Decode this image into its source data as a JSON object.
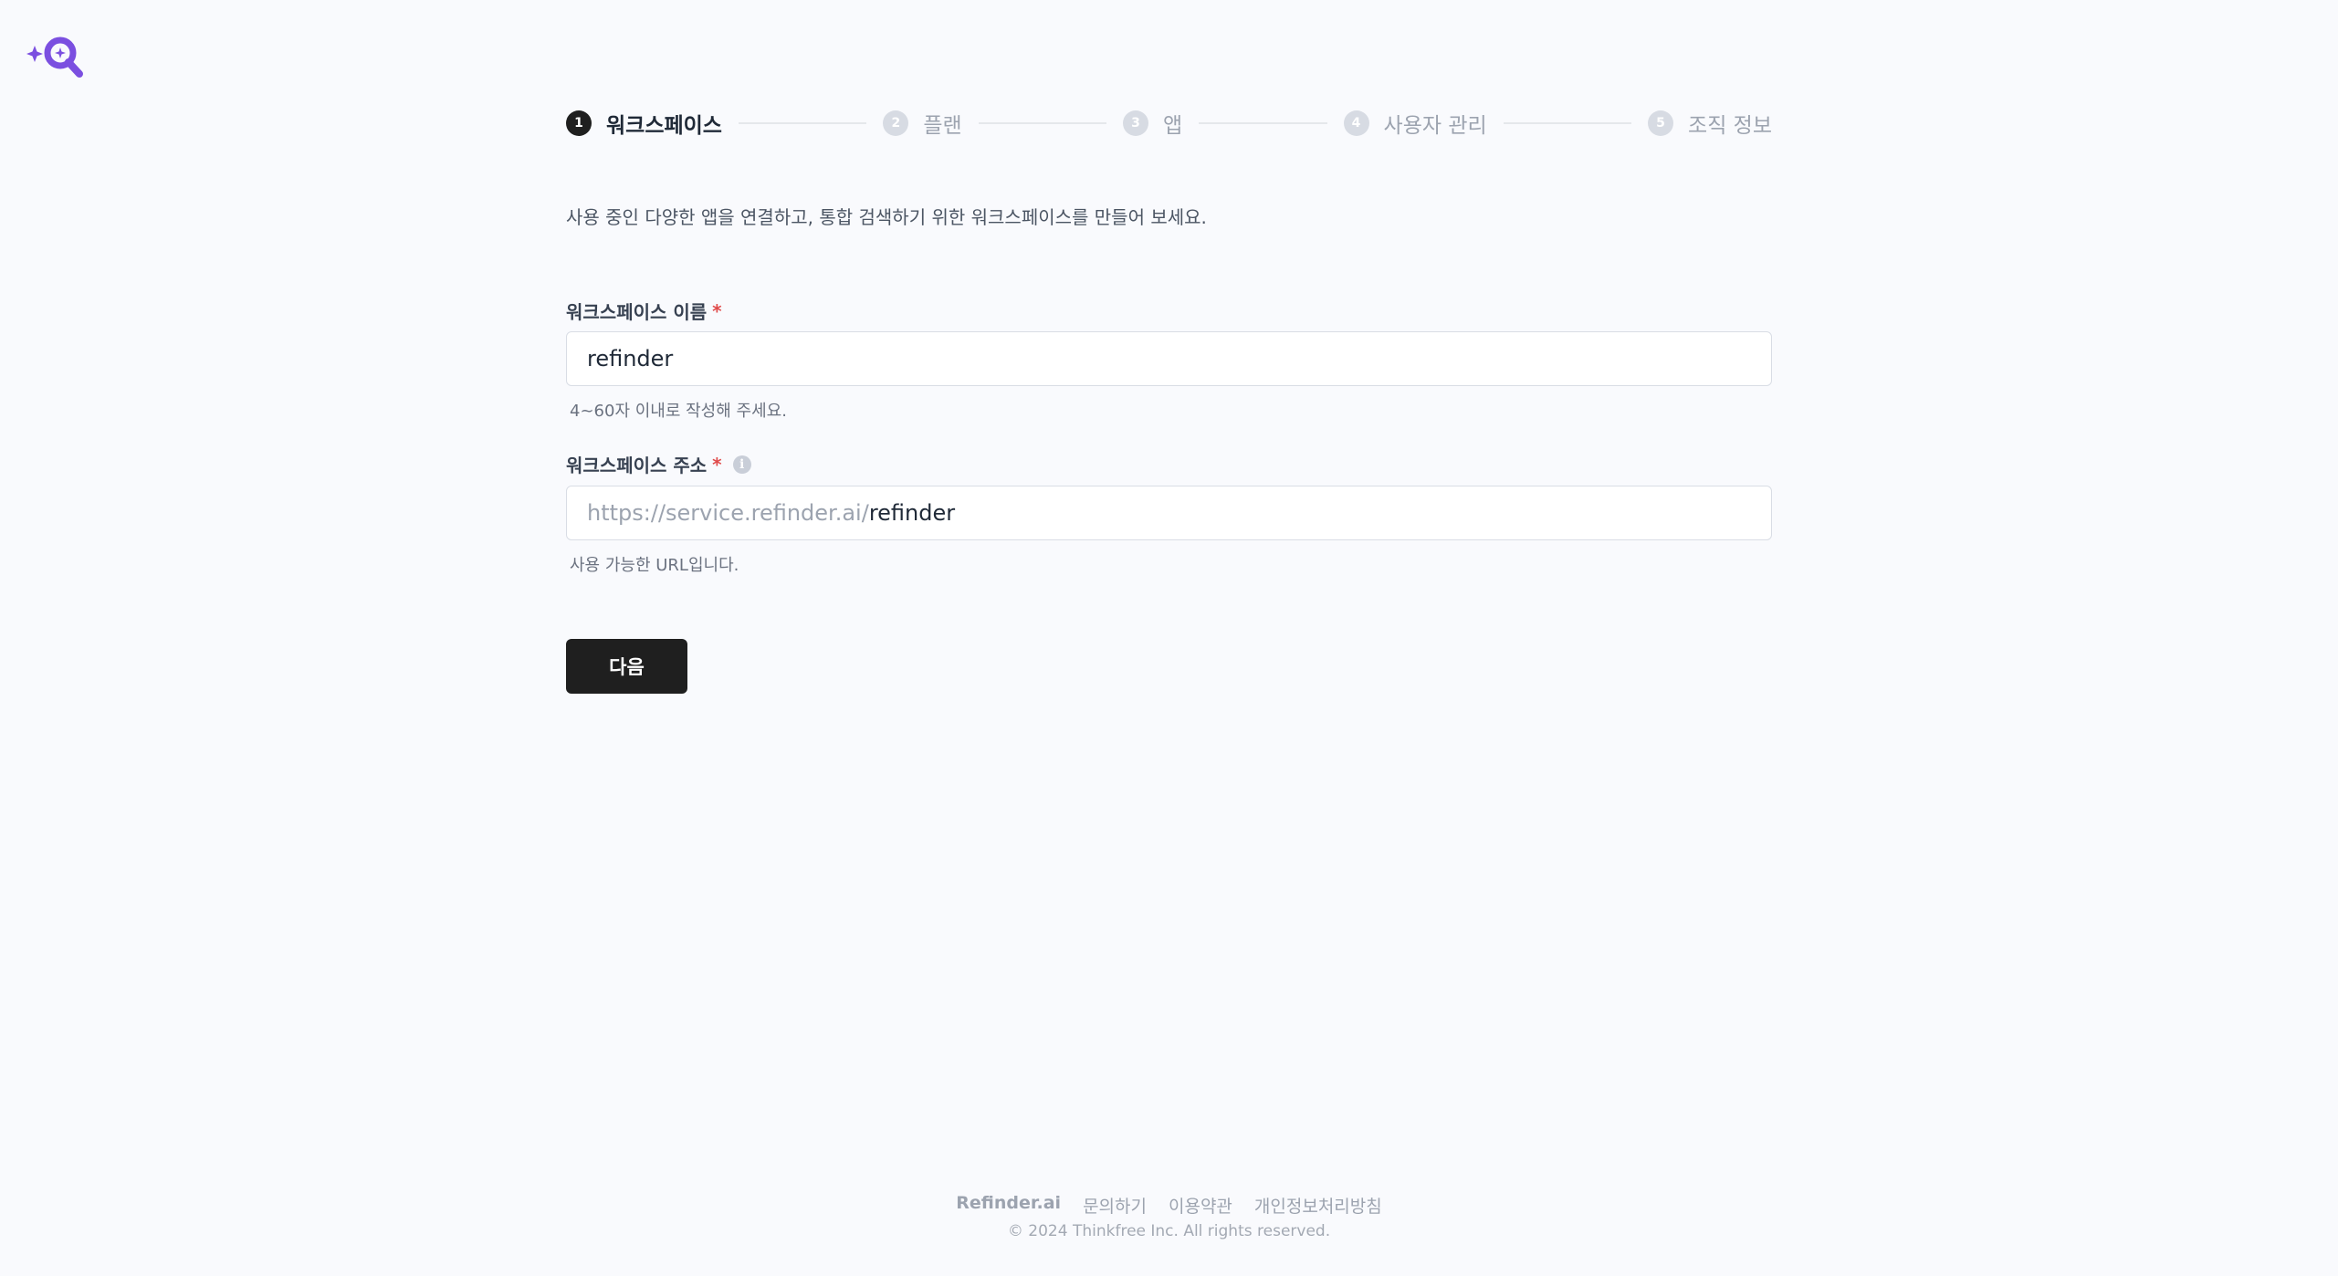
{
  "colors": {
    "brand_logo": "#7b4fe0",
    "primary_button": "#1f1f1f",
    "required_mark": "#e04b4b",
    "background": "#f9fafd"
  },
  "steps": [
    {
      "num": "1",
      "label": "워크스페이스",
      "state": "active"
    },
    {
      "num": "2",
      "label": "플랜",
      "state": "inactive"
    },
    {
      "num": "3",
      "label": "앱",
      "state": "inactive"
    },
    {
      "num": "4",
      "label": "사용자 관리",
      "state": "inactive"
    },
    {
      "num": "5",
      "label": "조직 정보",
      "state": "inactive"
    }
  ],
  "intro": "사용 중인 다양한 앱을 연결하고, 통합 검색하기 위한 워크스페이스를 만들어 보세요.",
  "workspace_name": {
    "label": "워크스페이스 이름",
    "required": "*",
    "value": "refinder",
    "help": "4~60자 이내로 작성해 주세요."
  },
  "workspace_url": {
    "label": "워크스페이스 주소",
    "required": "*",
    "info_icon": "i",
    "prefix": "https://service.refinder.ai/",
    "value": "refinder",
    "help": "사용 가능한 URL입니다."
  },
  "next_button": "다음",
  "footer": {
    "links": [
      "Refinder.ai",
      "문의하기",
      "이용약관",
      "개인정보처리방침"
    ],
    "copyright": "© 2024 Thinkfree Inc. All rights reserved."
  }
}
